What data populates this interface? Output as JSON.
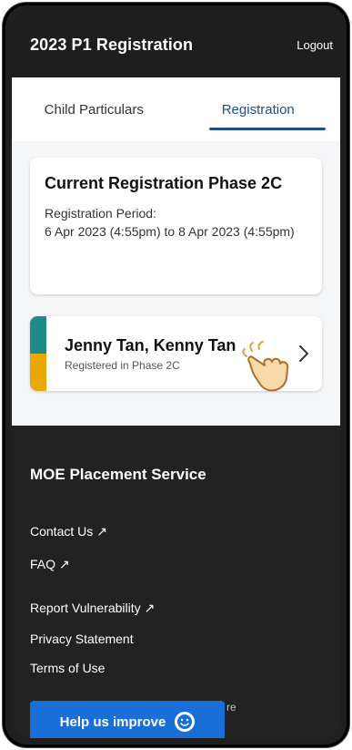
{
  "header": {
    "title": "2023 P1 Registration",
    "logout_label": "Logout"
  },
  "tabs": [
    {
      "label": "Child Particulars",
      "active": false
    },
    {
      "label": "Registration",
      "active": true
    }
  ],
  "phase_card": {
    "heading": "Current Registration Phase 2C",
    "period_label": "Registration Period:",
    "period_value": "6 Apr 2023 (4:55pm) to 8 Apr 2023 (4:55pm)"
  },
  "child_card": {
    "names": "Jenny Tan, Kenny Tan",
    "status": "Registered in Phase 2C",
    "stripe_colors": [
      "#1f8a8a",
      "#e8a800"
    ]
  },
  "footer": {
    "brand": "MOE Placement Service",
    "links": [
      {
        "label": "Contact Us",
        "external": true
      },
      {
        "label": "FAQ",
        "external": true
      },
      {
        "label": "Report Vulnerability",
        "external": true
      },
      {
        "label": "Privacy Statement",
        "external": false
      },
      {
        "label": "Terms of Use",
        "external": false
      }
    ],
    "peek_text": "re"
  },
  "help_button": {
    "label": "Help us improve",
    "icon": "smiley-icon"
  },
  "colors": {
    "accent": "#1c4e91",
    "help_button": "#1a6ed8",
    "dark_bg": "#222222"
  }
}
